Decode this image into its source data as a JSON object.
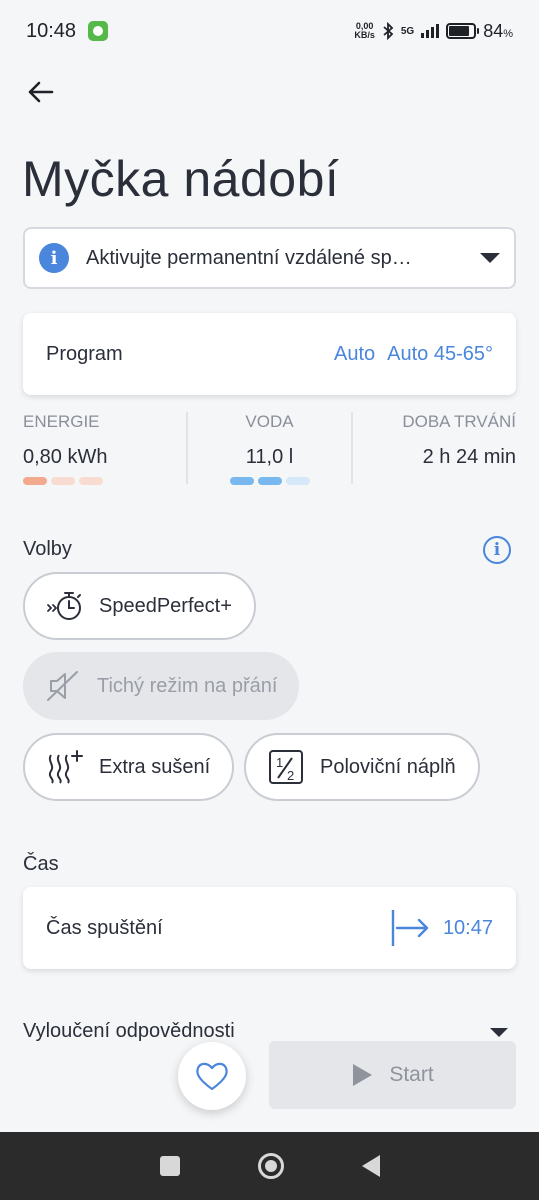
{
  "status_bar": {
    "time": "10:48",
    "net_speed_value": "0,00",
    "net_speed_unit": "KB/s",
    "network": "5G",
    "battery_percent": "84",
    "battery_unit": "%",
    "battery_level": 0.84
  },
  "header": {
    "back_icon": "arrow-left-icon",
    "title": "Myčka nádobí"
  },
  "remote_banner": {
    "text": "Aktivujte permanentní vzdálené sp…",
    "icon": "info-icon"
  },
  "program": {
    "label": "Program",
    "value_mode": "Auto",
    "value_program": "Auto 45-65°"
  },
  "stats": {
    "energy": {
      "label": "ENERGIE",
      "value": "0,80 kWh",
      "level": 1,
      "colors": [
        "#f2a98e",
        "#f8dcd2"
      ]
    },
    "water": {
      "label": "VODA",
      "value": "11,0 l",
      "level": 2,
      "colors": [
        "#79b8ef",
        "#d4e8f9"
      ]
    },
    "duration": {
      "label": "DOBA TRVÁNÍ",
      "value": "2 h 24 min"
    }
  },
  "options": {
    "title": "Volby",
    "help_icon": "info-outline-icon",
    "items": [
      {
        "label": "SpeedPerfect+",
        "icon": "stopwatch-speed-icon",
        "enabled": true
      },
      {
        "label": "Tichý režim na přání",
        "icon": "speaker-muted-icon",
        "enabled": false
      },
      {
        "label": "Extra sušení",
        "icon": "steam-plus-icon",
        "enabled": true
      },
      {
        "label": "Poloviční náplň",
        "icon": "half-load-icon",
        "enabled": true
      }
    ]
  },
  "time_section": {
    "title": "Čas",
    "start_label": "Čas spuštění",
    "start_value": "10:47",
    "start_icon": "arrow-to-right-icon"
  },
  "disclaimer": {
    "label": "Vyloučení odpovědnosti"
  },
  "actions": {
    "favorite_icon": "heart-icon",
    "start_label": "Start",
    "start_icon": "play-icon"
  },
  "colors": {
    "accent": "#4a86dc",
    "text": "#2b2f3a",
    "background": "#f5f6f8"
  }
}
